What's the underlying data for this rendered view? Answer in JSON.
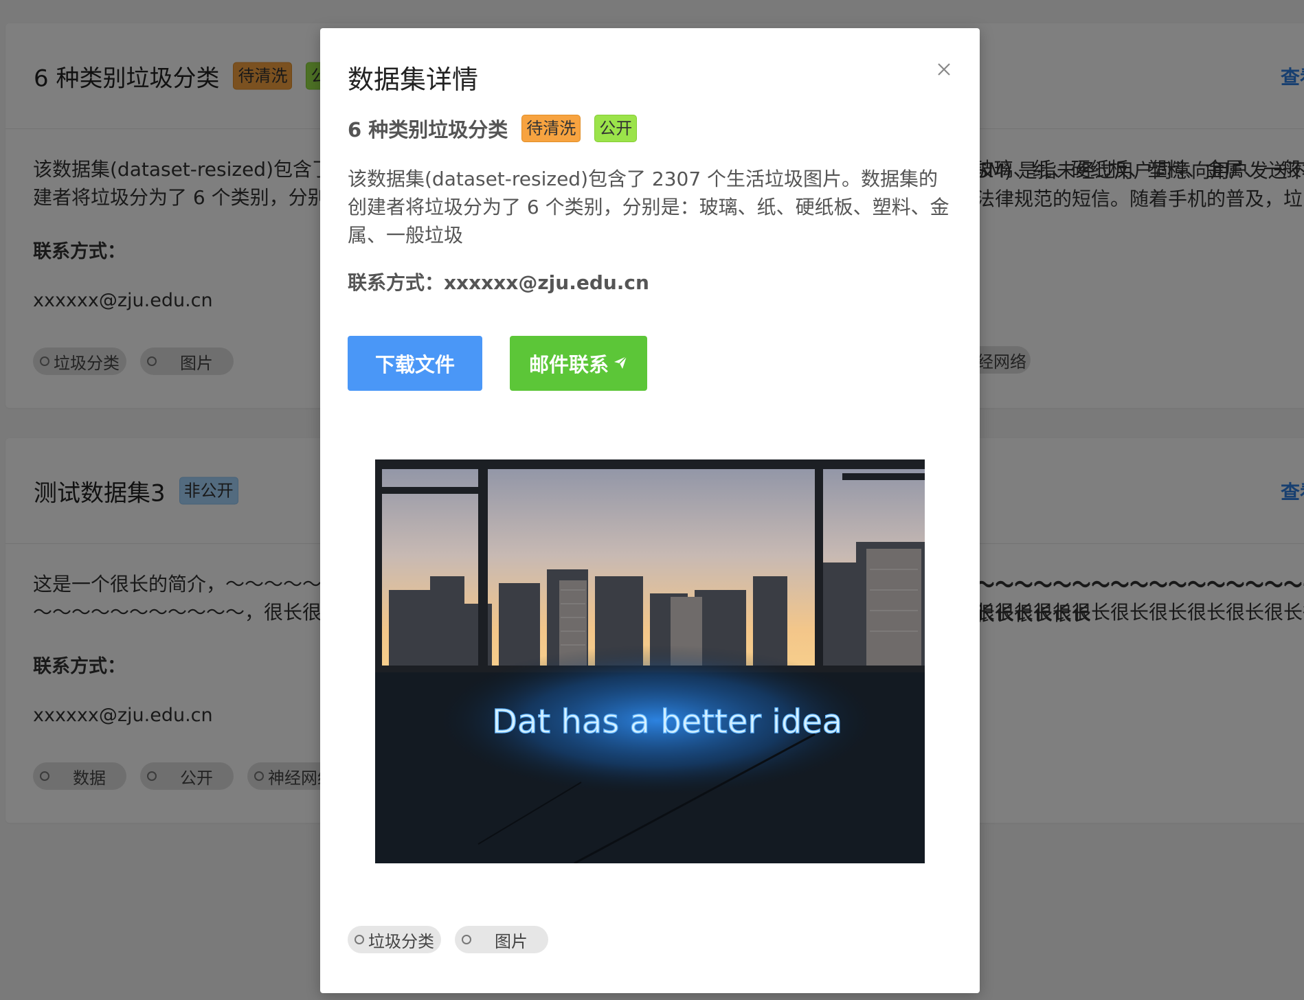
{
  "cards": [
    {
      "title": "6 种类别垃圾分类",
      "badges": [
        "待清洗",
        "公开"
      ],
      "view_link": "查看详",
      "desc_line1": "该数据集(dataset-resized)包含了 2307 个生活垃圾图片。数据集的创建者将垃圾分为了 6 个类别，分别是：玻璃、纸、硬纸板、塑料、金属、一般垃圾",
      "desc_line2": "建者将垃圾分为了 6 个类别，分别是：玻璃、纸、硬纸板、塑料、金属、一般垃圾",
      "contact_label": "联系方式：",
      "contact_value": "xxxxxx@zju.edu.cn",
      "tags": [
        "垃圾分类",
        "图片"
      ]
    },
    {
      "title": "测试数据集3",
      "badges": [
        "非公开"
      ],
      "view_link": "查看详",
      "desc_line1": "这是一个很长的简介，～～～～～～～～～～～～～～～～～～～～～～～～～～～～～～～～～～～～～～～～～～～～～～～～～～～～～～～～～～～～～～～～～～～～～～",
      "desc_line2": "～～～～～～～～～～～，很长很长很长很长很长很长很长很长很长很长很长很长很长很长很长很长很长很长很长很长很长很长很长很长很长很长很长很长很长很长很长很长很长很长很长很长很长很长很长",
      "contact_label": "联系方式：",
      "contact_value": "xxxxxx@zju.edu.cn",
      "tags": [
        "数据",
        "公开",
        "神经网络"
      ]
    }
  ],
  "right_partial": {
    "line1": "SM) 是指未经过用户同意向用户发送不",
    "line2": "法律规范的短信。随着手机的普及，垃",
    "tag": "经网络",
    "line3": "～～～～～～～～～～～～～～～～～～～",
    "line4": "很长很长很长"
  },
  "modal": {
    "title": "数据集详情",
    "dataset_name": "6 种类别垃圾分类",
    "badges": [
      "待清洗",
      "公开"
    ],
    "desc": "该数据集(dataset-resized)包含了 2307 个生活垃圾图片。数据集的创建者将垃圾分为了 6 个类别，分别是：玻璃、纸、硬纸板、塑料、金属、一般垃圾",
    "contact": "联系方式：xxxxxx@zju.edu.cn",
    "download_label": "下载文件",
    "mail_label": "邮件联系",
    "image_neon_text": "Dat  has a better idea",
    "tags": [
      "垃圾分类",
      "图片"
    ]
  },
  "colors": {
    "primary_blue": "#4a97f7",
    "success_green": "#5cc638",
    "badge_orange": "#f7a340",
    "badge_green": "#9be34a",
    "badge_blue": "#a7d6ff",
    "link_blue": "#2f7fe0"
  },
  "icons": {
    "close": "close-icon",
    "mail_send": "paper-plane-icon",
    "tag_bullet": "circle-icon"
  }
}
